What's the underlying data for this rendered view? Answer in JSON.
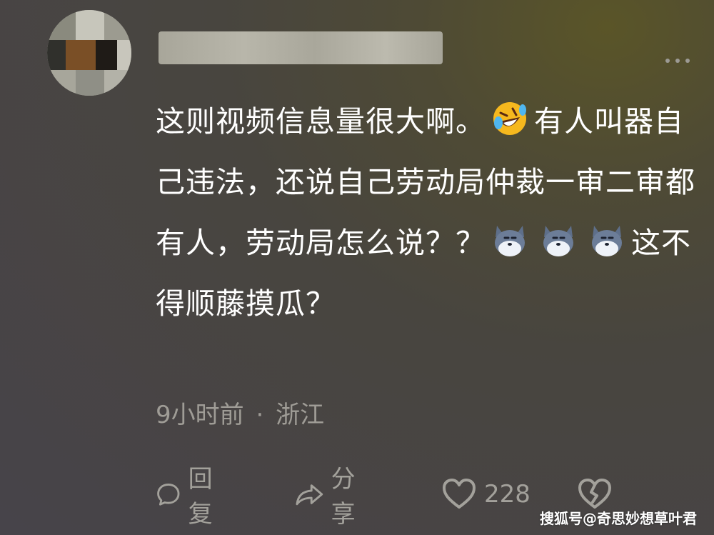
{
  "comment": {
    "text_part1": "这则视频信息量很大啊。",
    "text_part2": "有人叫器自己违法，还说自己劳动局仲裁一审二审都有人，劳动局怎么说？？",
    "text_part3": "这不得顺藤摸瓜？",
    "emoji_names": [
      "rolling-laughing-emoji",
      "husky-emoji",
      "husky-emoji",
      "husky-emoji"
    ]
  },
  "meta": {
    "time": "9小时前",
    "separator": "·",
    "location": "浙江"
  },
  "actions": {
    "reply_label": "回复",
    "share_label": "分享",
    "like_count": "228"
  },
  "watermark": "搜狐号@奇思妙想草叶君",
  "colors": {
    "text": "#ffffff",
    "meta_text": "#9f9c96",
    "background": "#47444a"
  }
}
